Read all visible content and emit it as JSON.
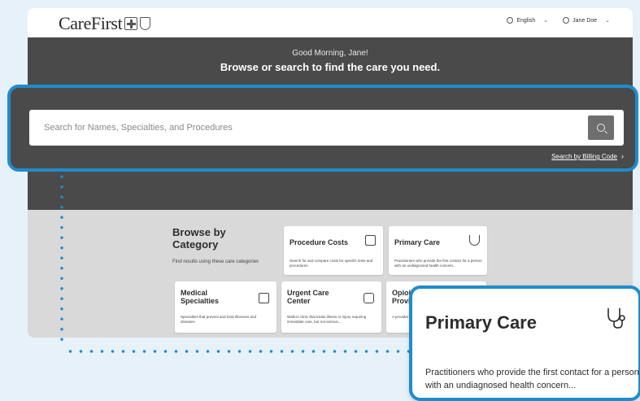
{
  "header": {
    "logo_text": "CareFirst",
    "language": "English",
    "user": "Jane Doe"
  },
  "hero": {
    "greeting": "Good Morning, Jane!",
    "headline": "Browse or search to find the care you need.",
    "search_placeholder": "Search for Names, Specialties, and Procedures",
    "billing_link": "Search by Billing Code"
  },
  "browse": {
    "title_line1": "Browse by",
    "title_line2": "Category",
    "subtitle": "Find results using these care categories",
    "cards": [
      {
        "title_line1": "Procedure Costs",
        "title_line2": "",
        "desc": "Search for and compare costs for specific tests and procedures.",
        "icon": "receipt-dollar-icon"
      },
      {
        "title_line1": "Primary Care",
        "title_line2": "",
        "desc": "Practitioners who provide the first contact for a person with an undiagnosed health concern...",
        "icon": "stethoscope-icon"
      },
      {
        "title_line1": "Medical",
        "title_line2": "Specialties",
        "desc": "Specialties that prevent and treat illnesses and diseases",
        "icon": "first-aid-kit-icon"
      },
      {
        "title_line1": "Urgent Care",
        "title_line2": "Center",
        "desc": "Walk-in clinic that treats illness or injury requiring immediate care, but not serious...",
        "icon": "ambulance-icon"
      },
      {
        "title_line1": "Opioid Treatment",
        "title_line2": "Provid",
        "desc": "A provider",
        "icon": "briefcase-medical-icon"
      }
    ]
  },
  "zoom": {
    "title": "Primary Care",
    "desc": "Practitioners who provide the first contact for a person with an undiagnosed health concern...",
    "icon": "stethoscope-icon"
  },
  "colors": {
    "accent": "#1f8ccb",
    "hero_bg": "#4a4a4a",
    "browse_bg": "#d9d9d9"
  }
}
